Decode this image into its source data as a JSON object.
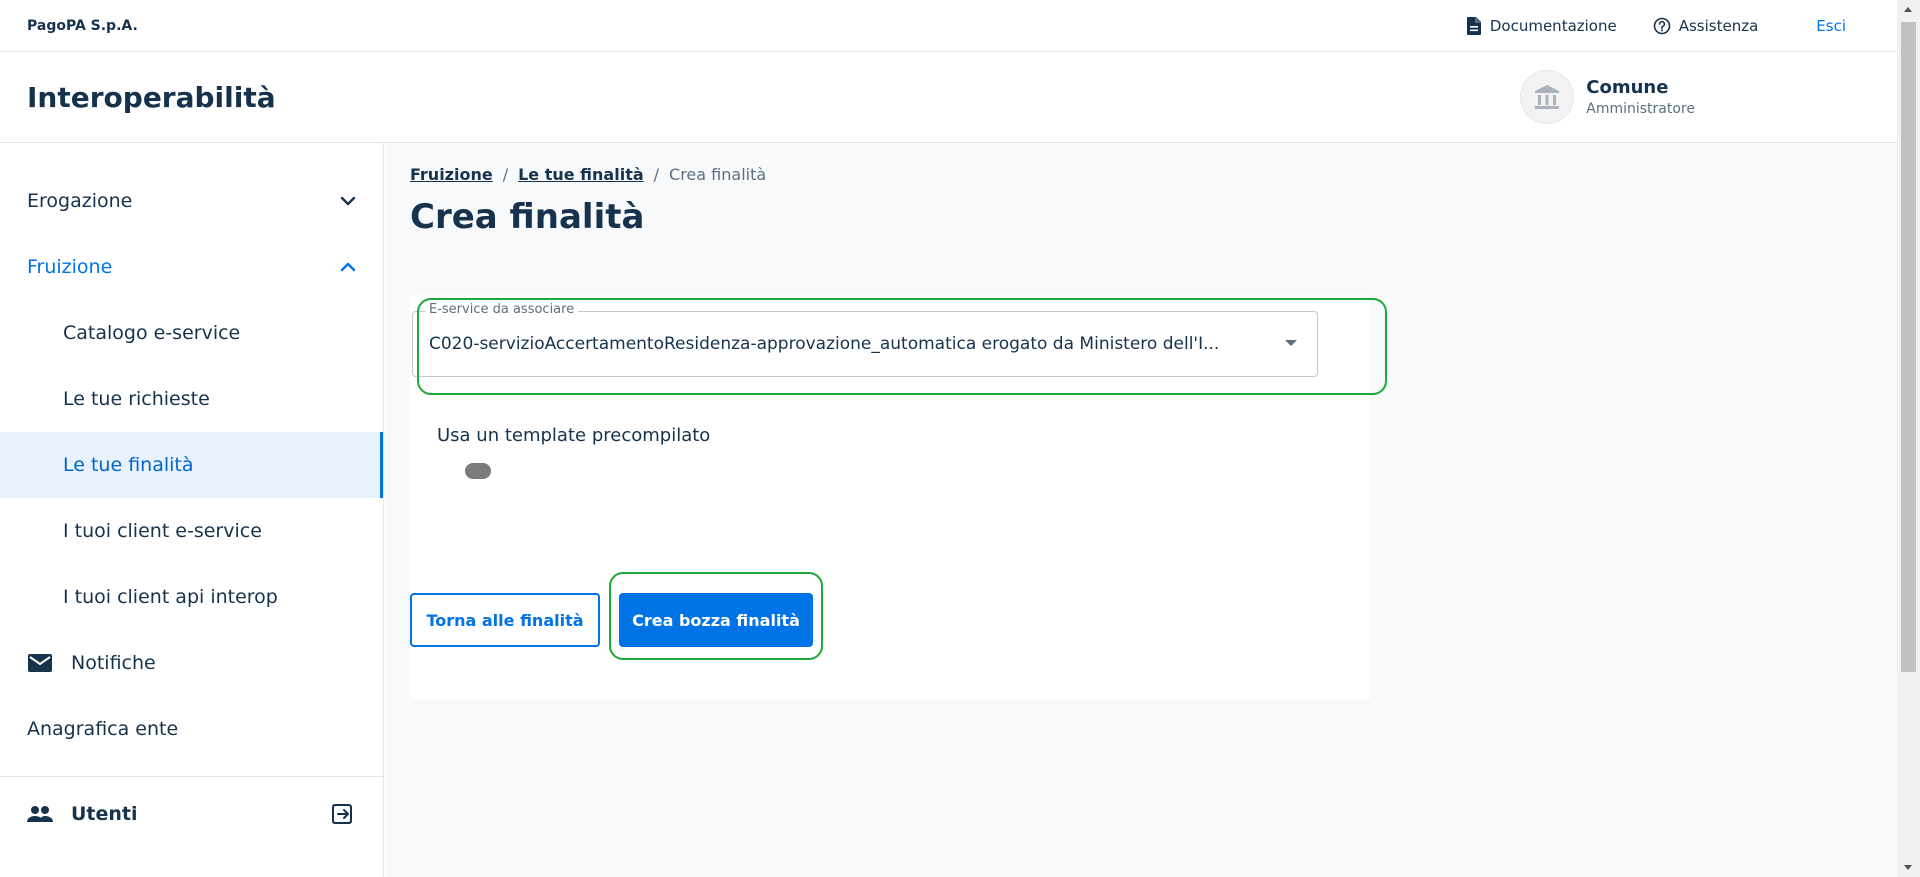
{
  "topbar": {
    "brand": "PagoPA S.p.A.",
    "documentation": "Documentazione",
    "support": "Assistenza",
    "logout": "Esci"
  },
  "header": {
    "product": "Interoperabilità",
    "party_name": "Comune",
    "party_role": "Amministratore"
  },
  "sidebar": {
    "items": [
      {
        "label": "Erogazione",
        "icon": "chevron-down-icon"
      },
      {
        "label": "Fruizione",
        "icon": "chevron-up-icon"
      },
      {
        "label": "Catalogo e-service"
      },
      {
        "label": "Le tue richieste"
      },
      {
        "label": "Le tue finalità"
      },
      {
        "label": "I tuoi client e-service"
      },
      {
        "label": "I tuoi client api interop"
      },
      {
        "label": "Notifiche",
        "icon": "mail-icon"
      },
      {
        "label": "Anagrafica ente"
      }
    ],
    "users": {
      "label": "Utenti",
      "icon": "people-icon",
      "action_icon": "exit-icon"
    }
  },
  "breadcrumb": {
    "items": [
      "Fruizione",
      "Le tue finalità"
    ],
    "separator": "/",
    "current": "Crea finalità"
  },
  "page": {
    "title": "Crea finalità"
  },
  "form": {
    "eservice_label": "E-service da associare",
    "eservice_value": "C020-servizioAccertamentoResidenza-approvazione_automatica erogato da Ministero dell'I...",
    "template_label": "Usa un template precompilato",
    "template_enabled": false
  },
  "actions": {
    "back": "Torna alle finalità",
    "create": "Crea bozza finalità"
  },
  "colors": {
    "primary": "#0073e6",
    "text": "#17324d",
    "highlight": "#1aaa3c"
  }
}
